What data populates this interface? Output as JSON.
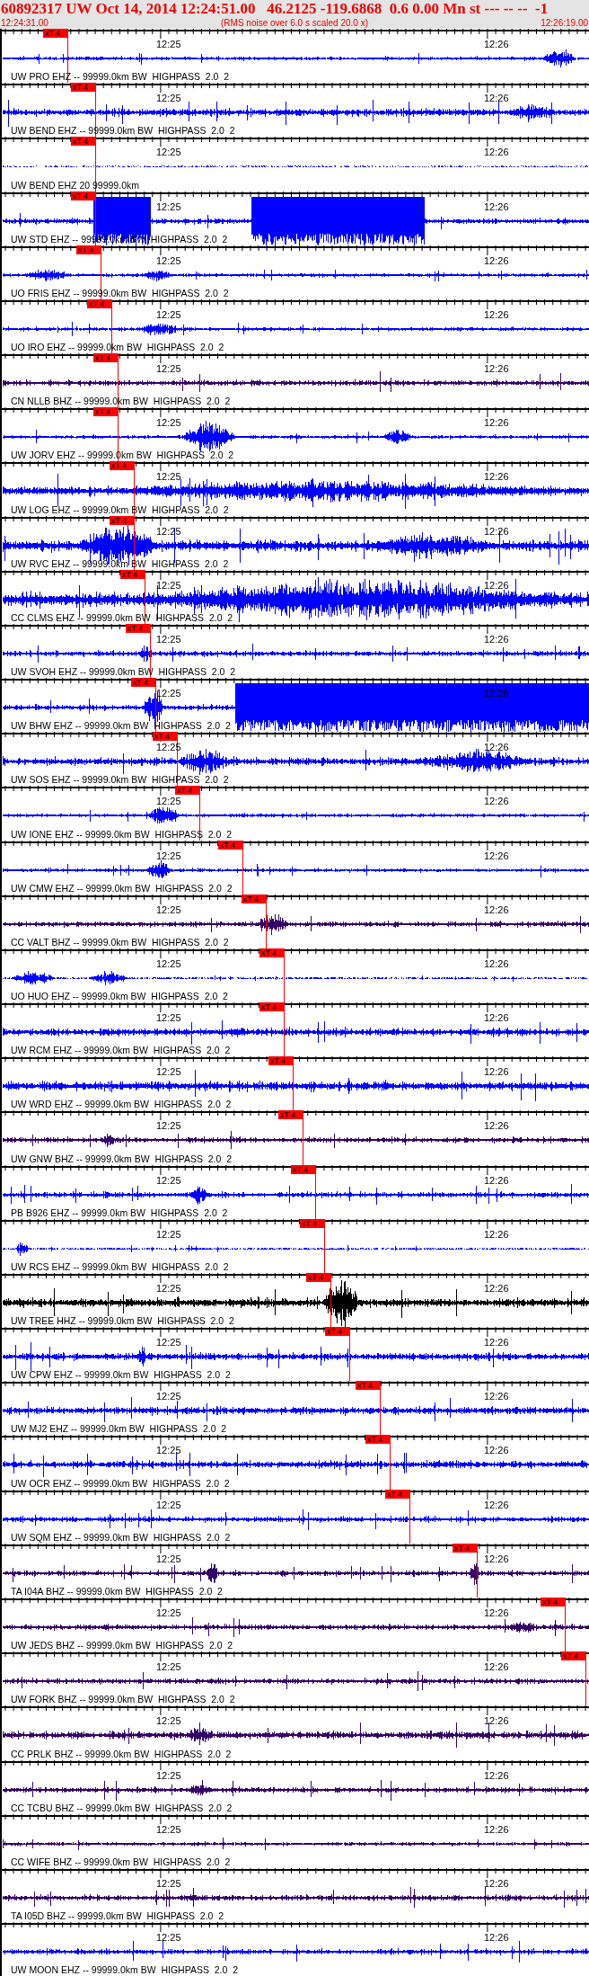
{
  "header": {
    "title": "60892317 UW Oct 14, 2014 12:24:51.00   46.2125 -119.6868  0.6 0.00 Mn st --- -- --  -1",
    "start_time": "12:24:31.00",
    "note": "(RMS noise over 6.0 s scaled 20.0 x)",
    "end_time": "12:26:19.00"
  },
  "traces": [
    {
      "label": "UW PRO EHZ -- 99999.0km BW  HIGHPASS  2.0  2",
      "color": "#0000ff",
      "time_labels": [
        "12:25",
        "12:26"
      ],
      "pick": "xT 4"
    },
    {
      "label": "UW BEND EHZ -- 99999.0km BW  HIGHPASS  2.0  2",
      "color": "#0000ff",
      "time_labels": [
        "12:25",
        "12:26"
      ],
      "pick": "xT 4"
    },
    {
      "label": "UW BEND EHZ 20 99999.0km",
      "color": "#0000ff",
      "time_labels": [
        "12:25",
        "12:26"
      ],
      "pick": "xT 4"
    },
    {
      "label": "UW STD EHZ -- 99999.0km BW  HIGHPASS  2.0  2",
      "color": "#0000ff",
      "time_labels": [
        "12:25",
        "12:26"
      ],
      "pick": "xT 4"
    },
    {
      "label": "UO FRIS EHZ -- 99999.0km BW  HIGHPASS  2.0  2",
      "color": "#0000ff",
      "time_labels": [
        "12:25",
        "12:26"
      ],
      "pick": "xT 4"
    },
    {
      "label": "UO IRO EHZ -- 99999.0km BW  HIGHPASS  2.0  2",
      "color": "#0000ff",
      "time_labels": [
        "12:25",
        "12:26"
      ],
      "pick": "xT 4"
    },
    {
      "label": "CN NLLB BHZ -- 99999.0km BW  HIGHPASS  2.0  2",
      "color": "#330066",
      "time_labels": [
        "12:25",
        "12:26"
      ],
      "pick": "xT 4"
    },
    {
      "label": "UW JORV EHZ -- 99999.0km BW  HIGHPASS  2.0  2",
      "color": "#0000ff",
      "time_labels": [
        "12:25",
        "12:26"
      ],
      "pick": "xT 4"
    },
    {
      "label": "UW LOG EHZ -- 99999.0km BW  HIGHPASS  2.0  2",
      "color": "#0000ff",
      "time_labels": [
        "12:25",
        "12:26"
      ],
      "pick": "xT 4"
    },
    {
      "label": "UW RVC EHZ -- 99999.0km BW  HIGHPASS  2.0  2",
      "color": "#0000ff",
      "time_labels": [
        "12:25",
        "12:26"
      ],
      "pick": "xT 4"
    },
    {
      "label": "CC CLMS EHZ -- 99999.0km BW  HIGHPASS  2.0  2",
      "color": "#0000ff",
      "time_labels": [
        "12:25",
        "12:26"
      ],
      "pick": "xT 4"
    },
    {
      "label": "UW SVOH EHZ -- 99999.0km BW  HIGHPASS  2.0  2",
      "color": "#0000ff",
      "time_labels": [
        "12:25",
        "12:26"
      ],
      "pick": "xT 4"
    },
    {
      "label": "UW BHW EHZ -- 99999.0km BW  HIGHPASS  2.0  2",
      "color": "#0000ff",
      "time_labels": [
        "12:25",
        "12:26"
      ],
      "pick": "xT 4"
    },
    {
      "label": "UW SOS EHZ -- 99999.0km BW  HIGHPASS  2.0  2",
      "color": "#0000ff",
      "time_labels": [
        "12:25",
        "12:26"
      ],
      "pick": "xT 4"
    },
    {
      "label": "UW IONE EHZ -- 99999.0km BW  HIGHPASS  2.0  2",
      "color": "#0000ff",
      "time_labels": [
        "12:25",
        "12:26"
      ],
      "pick": "xT 4"
    },
    {
      "label": "UW CMW EHZ -- 99999.0km BW  HIGHPASS  2.0  2",
      "color": "#0000ff",
      "time_labels": [
        "12:25",
        "12:26"
      ],
      "pick": "xT 4"
    },
    {
      "label": "CC VALT BHZ -- 99999.0km BW  HIGHPASS  2.0  2",
      "color": "#330066",
      "time_labels": [
        "12:25",
        "12:26"
      ],
      "pick": "xT 4"
    },
    {
      "label": "UO HUO EHZ -- 99999.0km BW  HIGHPASS  2.0  2",
      "color": "#0000ff",
      "time_labels": [
        "12:25",
        "12:26"
      ],
      "pick": "xT 4"
    },
    {
      "label": "UW RCM EHZ -- 99999.0km BW  HIGHPASS  2.0  2",
      "color": "#0000ff",
      "time_labels": [
        "12:25",
        "12:26"
      ],
      "pick": "xT 4"
    },
    {
      "label": "UW WRD EHZ -- 99999.0km BW  HIGHPASS  2.0  2",
      "color": "#0000ff",
      "time_labels": [
        "12:25",
        "12:26"
      ],
      "pick": "xT 4"
    },
    {
      "label": "UW GNW BHZ -- 99999.0km BW  HIGHPASS  2.0  2",
      "color": "#330066",
      "time_labels": [
        "12:25",
        "12:26"
      ],
      "pick": "xT 4"
    },
    {
      "label": "PB B926 EHZ -- 99999.0km BW  HIGHPASS  2.0  2",
      "color": "#0000ff",
      "time_labels": [
        "12:25",
        "12:26"
      ],
      "pick": "xT 4"
    },
    {
      "label": "UW RCS EHZ -- 99999.0km BW  HIGHPASS  2.0  2",
      "color": "#0000ff",
      "time_labels": [
        "12:25",
        "12:26"
      ],
      "pick": "xT 4"
    },
    {
      "label": "UW TREE HHZ -- 99999.0km BW  HIGHPASS  2.0  2",
      "color": "#000000",
      "time_labels": [
        "12:25",
        "12:26"
      ],
      "pick": "xT 4"
    },
    {
      "label": "UW CPW EHZ -- 99999.0km BW  HIGHPASS  2.0  2",
      "color": "#0000ff",
      "time_labels": [
        "12:25",
        "12:26"
      ],
      "pick": "xT 4"
    },
    {
      "label": "UW MJ2 EHZ -- 99999.0km BW  HIGHPASS  2.0  2",
      "color": "#0000ff",
      "time_labels": [
        "12:25",
        "12:26"
      ],
      "pick": "xT 4"
    },
    {
      "label": "UW OCR EHZ -- 99999.0km BW  HIGHPASS  2.0  2",
      "color": "#0000ff",
      "time_labels": [
        "12:25",
        "12:26"
      ],
      "pick": "xT 4"
    },
    {
      "label": "UW SQM EHZ -- 99999.0km BW  HIGHPASS  2.0  2",
      "color": "#0000ff",
      "time_labels": [
        "12:25",
        "12:26"
      ],
      "pick": "xT 4"
    },
    {
      "label": "TA I04A BHZ -- 99999.0km BW  HIGHPASS  2.0  2",
      "color": "#330066",
      "time_labels": [
        "12:25",
        "12:26"
      ],
      "pick": "xT 4"
    },
    {
      "label": "UW JEDS BHZ -- 99999.0km BW  HIGHPASS  2.0  2",
      "color": "#330066",
      "time_labels": [
        "12:25",
        "12:26"
      ],
      "pick": "xT 4"
    },
    {
      "label": "UW FORK BHZ -- 99999.0km BW  HIGHPASS  2.0  2",
      "color": "#330066",
      "time_labels": [
        "12:25",
        "12:26"
      ],
      "pick": "xT 4"
    },
    {
      "label": "CC PRLK BHZ -- 99999.0km BW  HIGHPASS  2.0  2",
      "color": "#330066",
      "time_labels": [
        "12:25",
        "12:26"
      ]
    },
    {
      "label": "CC TCBU BHZ -- 99999.0km BW  HIGHPASS  2.0  2",
      "color": "#330066",
      "time_labels": [
        "12:25",
        "12:26"
      ]
    },
    {
      "label": "CC WIFE BHZ -- 99999.0km BW  HIGHPASS  2.0  2",
      "color": "#330066",
      "time_labels": [
        "12:25",
        "12:26"
      ]
    },
    {
      "label": "TA I05D BHZ -- 99999.0km BW  HIGHPASS  2.0  2",
      "color": "#330066",
      "time_labels": [
        "12:25",
        "12:26"
      ]
    },
    {
      "label": "UW MOON EHZ -- 99999.0km BW  HIGHPASS  2.0  2",
      "color": "#0000ff",
      "time_labels": [
        "12:25",
        "12:26"
      ]
    }
  ]
}
